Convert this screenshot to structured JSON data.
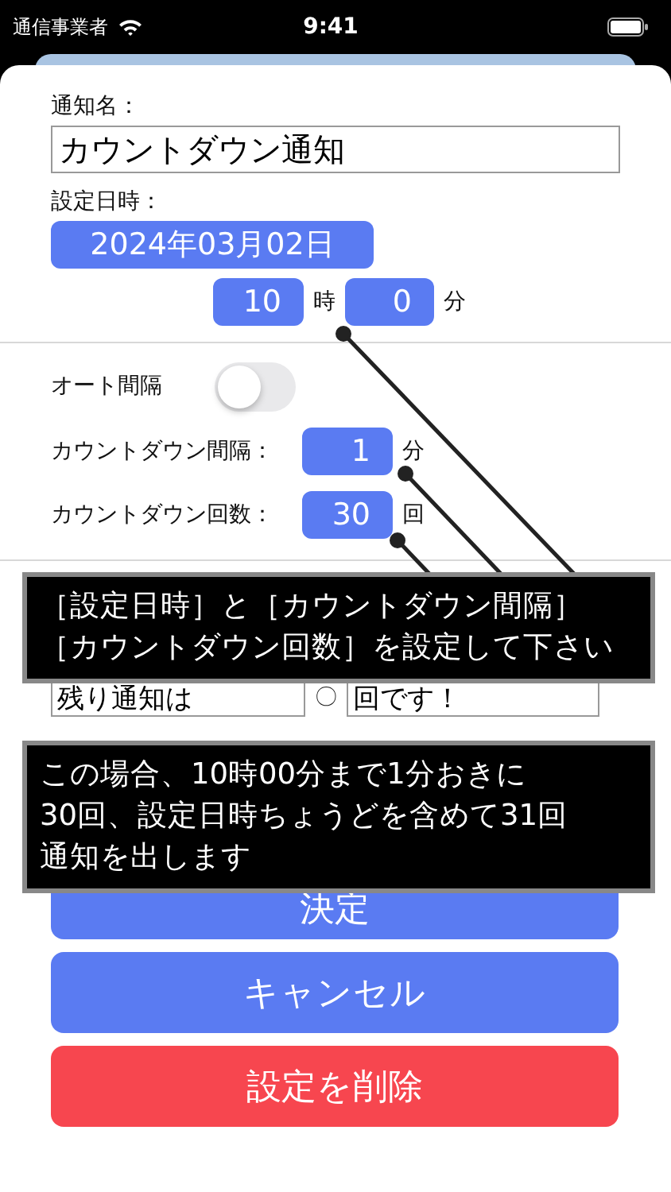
{
  "status_bar": {
    "carrier": "通信事業者",
    "time": "9:41"
  },
  "form": {
    "name_label": "通知名：",
    "name_value": "カウントダウン通知",
    "datetime_label": "設定日時：",
    "date": "2024年03月02日",
    "hour": "10",
    "hour_unit": "時",
    "minute": "0",
    "minute_unit": "分"
  },
  "auto_interval": {
    "label": "オート間隔",
    "on": false
  },
  "interval": {
    "label": "カウントダウン間隔：",
    "value": "1",
    "unit": "分"
  },
  "count": {
    "label": "カウントダウン回数：",
    "value": "30",
    "unit": "回"
  },
  "message": {
    "prefix": "残り通知は",
    "count": "〇",
    "suffix": "回です！"
  },
  "buttons": [
    {
      "label": "決定",
      "kind": "primary"
    },
    {
      "label": "キャンセル",
      "kind": "primary"
    },
    {
      "label": "設定を削除",
      "kind": "danger"
    }
  ],
  "callouts": [
    {
      "lines": [
        "［設定日時］と［カウントダウン間隔］",
        "［カウントダウン回数］を設定して下さい"
      ]
    },
    {
      "lines": [
        "この場合、10時00分まで1分おきに",
        "30回、設定日時ちょうどを含めて31回",
        "通知を出します"
      ]
    }
  ]
}
